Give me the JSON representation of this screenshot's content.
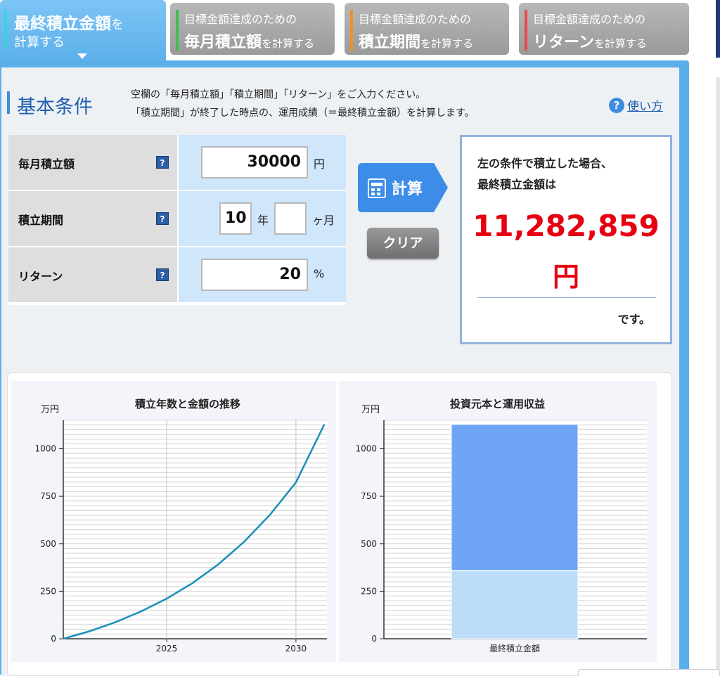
{
  "tabs": [
    {
      "line1": "最終積立金額",
      "line1_suffix": "を",
      "line2": "計算する"
    },
    {
      "line1": "目標金額達成のための",
      "line2": "毎月積立額",
      "line2_suffix": "を計算する",
      "accent": "#3fbf4f"
    },
    {
      "line1": "目標金額達成のための",
      "line2": "積立期間",
      "line2_suffix": "を計算する",
      "accent": "#f0902a"
    },
    {
      "line1": "目標金額達成のための",
      "line2": "リターン",
      "line2_suffix": "を計算する",
      "accent": "#e84a4a"
    }
  ],
  "section": {
    "title": "基本条件",
    "desc1": "空欄の「毎月積立額」「積立期間」「リターン」をご入力ください。",
    "desc2": "「積立期間」が終了した時点の、運用成績（＝最終積立金額）を計算します。",
    "help_icon": "?",
    "help_label": "使い方"
  },
  "form": {
    "help_glyph": "?",
    "monthly_label": "毎月積立額",
    "monthly_value": "30000",
    "monthly_unit": "円",
    "period_label": "積立期間",
    "period_years": "10",
    "period_years_unit": "年",
    "period_months": "",
    "period_months_unit": "ヶ月",
    "return_label": "リターン",
    "return_value": "20",
    "return_unit": "%"
  },
  "buttons": {
    "calc": "計算",
    "clear": "クリア"
  },
  "result": {
    "line1": "左の条件で積立した場合、",
    "line2": "最終積立金額は",
    "amount": "11,282,859",
    "yen": "円",
    "suffix": "です。"
  },
  "colors": {
    "accent": "#5aaeea",
    "result_red": "#e60012",
    "line": "#1a8fb8",
    "bar_top": "#6ea6f5",
    "bar_bottom": "#bcdcf8"
  },
  "chart_data": [
    {
      "type": "line",
      "title": "積立年数と金額の推移",
      "ylabel": "万円",
      "xlabel": "",
      "x": [
        2021,
        2022,
        2023,
        2024,
        2025,
        2026,
        2027,
        2028,
        2029,
        2030,
        2031
      ],
      "series": [
        {
          "values": [
            0,
            39,
            86,
            143,
            211,
            293,
            392,
            511,
            653,
            823,
            1128
          ]
        }
      ],
      "xticks": [
        "2025",
        "2030"
      ],
      "yticks": [
        "0",
        "250",
        "500",
        "750",
        "1000"
      ],
      "ylim": [
        0,
        1150
      ]
    },
    {
      "type": "bar",
      "title": "投資元本と運用収益",
      "ylabel": "万円",
      "categories": [
        "最終積立金額"
      ],
      "series": [
        {
          "values": [
            360
          ]
        },
        {
          "values": [
            768
          ]
        }
      ],
      "yticks": [
        "0",
        "250",
        "500",
        "750",
        "1000"
      ],
      "ylim": [
        0,
        1150
      ]
    }
  ]
}
